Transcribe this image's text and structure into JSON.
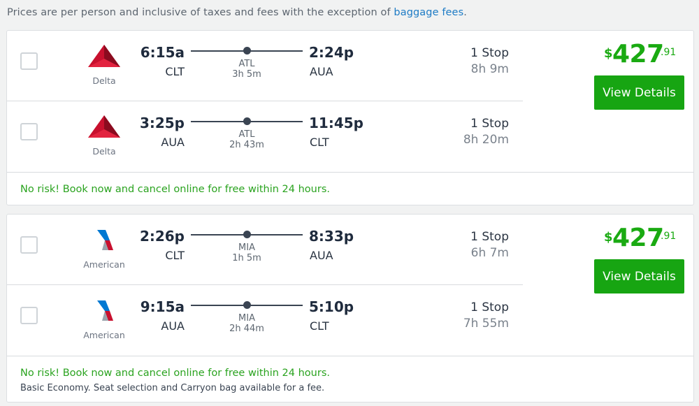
{
  "notice": {
    "text": "Prices are per person and inclusive of taxes and fees with the exception of ",
    "link": "baggage fees",
    "suffix": "."
  },
  "colors": {
    "price_green": "#1aaa12",
    "button_green": "#17a512",
    "link_blue": "#1d7bc5",
    "delta_red": "#c8102e",
    "american_blue": "#0078d2"
  },
  "results": [
    {
      "legs": [
        {
          "airline": "Delta",
          "logo": "delta-logo-icon",
          "dep_time": "6:15a",
          "dep_code": "CLT",
          "via": "ATL",
          "layover": "3h 5m",
          "arr_time": "2:24p",
          "arr_code": "AUA",
          "stops": "1 Stop",
          "duration": "8h 9m"
        },
        {
          "airline": "Delta",
          "logo": "delta-logo-icon",
          "dep_time": "3:25p",
          "dep_code": "AUA",
          "via": "ATL",
          "layover": "2h 43m",
          "arr_time": "11:45p",
          "arr_code": "CLT",
          "stops": "1 Stop",
          "duration": "8h 20m"
        }
      ],
      "price": {
        "currency": "$",
        "dollars": "427",
        "cents": ".91"
      },
      "button": "View Details",
      "risk": "No risk! Book now and cancel online for free within 24 hours."
    },
    {
      "legs": [
        {
          "airline": "American",
          "logo": "american-logo-icon",
          "dep_time": "2:26p",
          "dep_code": "CLT",
          "via": "MIA",
          "layover": "1h 5m",
          "arr_time": "8:33p",
          "arr_code": "AUA",
          "stops": "1 Stop",
          "duration": "6h 7m"
        },
        {
          "airline": "American",
          "logo": "american-logo-icon",
          "dep_time": "9:15a",
          "dep_code": "AUA",
          "via": "MIA",
          "layover": "2h 44m",
          "arr_time": "5:10p",
          "arr_code": "CLT",
          "stops": "1 Stop",
          "duration": "7h 55m"
        }
      ],
      "price": {
        "currency": "$",
        "dollars": "427",
        "cents": ".91"
      },
      "button": "View Details",
      "risk": "No risk! Book now and cancel online for free within 24 hours.",
      "note": "Basic Economy. Seat selection and Carryon bag available for a fee."
    }
  ]
}
